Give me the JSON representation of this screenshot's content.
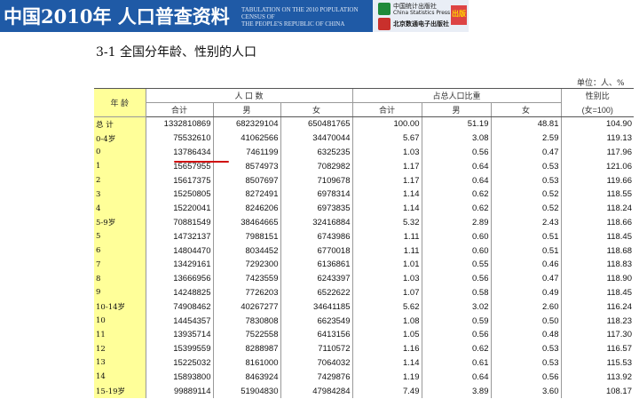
{
  "banner": {
    "title": "中国2010年  人口普查资料",
    "subtitle_line1": "TABULATION ON THE 2010 POPULATION CENSUS OF",
    "subtitle_line2": "THE PEOPLE'S REPUBLIC OF CHINA",
    "press_cn": "中国统计出版社",
    "press_en": "China Statistics Press",
    "publisher": "北京数通电子出版社",
    "badge": "出版"
  },
  "page_title": "3-1  全国分年龄、性别的人口",
  "unit": "单位：人、%",
  "headers": {
    "age": "年    龄",
    "population": "人    口    数",
    "share": "占总人口比重",
    "sex_ratio": "性别比",
    "total": "合计",
    "male": "男",
    "female": "女",
    "ratio_basis": "(女=100)"
  },
  "rows": [
    {
      "age": "总  计",
      "total": "1332810869",
      "male": "682329104",
      "female": "650481765",
      "p_total": "100.00",
      "p_male": "51.19",
      "p_female": "48.81",
      "ratio": "104.90"
    },
    {
      "age": "0-4岁",
      "total": "75532610",
      "male": "41062566",
      "female": "34470044",
      "p_total": "5.67",
      "p_male": "3.08",
      "p_female": "2.59",
      "ratio": "119.13"
    },
    {
      "age": "0",
      "total": "13786434",
      "male": "7461199",
      "female": "6325235",
      "p_total": "1.03",
      "p_male": "0.56",
      "p_female": "0.47",
      "ratio": "117.96"
    },
    {
      "age": "1",
      "total": "15657955",
      "male": "8574973",
      "female": "7082982",
      "p_total": "1.17",
      "p_male": "0.64",
      "p_female": "0.53",
      "ratio": "121.06"
    },
    {
      "age": "2",
      "total": "15617375",
      "male": "8507697",
      "female": "7109678",
      "p_total": "1.17",
      "p_male": "0.64",
      "p_female": "0.53",
      "ratio": "119.66"
    },
    {
      "age": "3",
      "total": "15250805",
      "male": "8272491",
      "female": "6978314",
      "p_total": "1.14",
      "p_male": "0.62",
      "p_female": "0.52",
      "ratio": "118.55"
    },
    {
      "age": "4",
      "total": "15220041",
      "male": "8246206",
      "female": "6973835",
      "p_total": "1.14",
      "p_male": "0.62",
      "p_female": "0.52",
      "ratio": "118.24"
    },
    {
      "age": "5-9岁",
      "total": "70881549",
      "male": "38464665",
      "female": "32416884",
      "p_total": "5.32",
      "p_male": "2.89",
      "p_female": "2.43",
      "ratio": "118.66"
    },
    {
      "age": "5",
      "total": "14732137",
      "male": "7988151",
      "female": "6743986",
      "p_total": "1.11",
      "p_male": "0.60",
      "p_female": "0.51",
      "ratio": "118.45"
    },
    {
      "age": "6",
      "total": "14804470",
      "male": "8034452",
      "female": "6770018",
      "p_total": "1.11",
      "p_male": "0.60",
      "p_female": "0.51",
      "ratio": "118.68"
    },
    {
      "age": "7",
      "total": "13429161",
      "male": "7292300",
      "female": "6136861",
      "p_total": "1.01",
      "p_male": "0.55",
      "p_female": "0.46",
      "ratio": "118.83"
    },
    {
      "age": "8",
      "total": "13666956",
      "male": "7423559",
      "female": "6243397",
      "p_total": "1.03",
      "p_male": "0.56",
      "p_female": "0.47",
      "ratio": "118.90"
    },
    {
      "age": "9",
      "total": "14248825",
      "male": "7726203",
      "female": "6522622",
      "p_total": "1.07",
      "p_male": "0.58",
      "p_female": "0.49",
      "ratio": "118.45"
    },
    {
      "age": "10-14岁",
      "total": "74908462",
      "male": "40267277",
      "female": "34641185",
      "p_total": "5.62",
      "p_male": "3.02",
      "p_female": "2.60",
      "ratio": "116.24"
    },
    {
      "age": "10",
      "total": "14454357",
      "male": "7830808",
      "female": "6623549",
      "p_total": "1.08",
      "p_male": "0.59",
      "p_female": "0.50",
      "ratio": "118.23"
    },
    {
      "age": "11",
      "total": "13935714",
      "male": "7522558",
      "female": "6413156",
      "p_total": "1.05",
      "p_male": "0.56",
      "p_female": "0.48",
      "ratio": "117.30"
    },
    {
      "age": "12",
      "total": "15399559",
      "male": "8288987",
      "female": "7110572",
      "p_total": "1.16",
      "p_male": "0.62",
      "p_female": "0.53",
      "ratio": "116.57"
    },
    {
      "age": "13",
      "total": "15225032",
      "male": "8161000",
      "female": "7064032",
      "p_total": "1.14",
      "p_male": "0.61",
      "p_female": "0.53",
      "ratio": "115.53"
    },
    {
      "age": "14",
      "total": "15893800",
      "male": "8463924",
      "female": "7429876",
      "p_total": "1.19",
      "p_male": "0.64",
      "p_female": "0.56",
      "ratio": "113.92"
    },
    {
      "age": "15-19岁",
      "total": "99889114",
      "male": "51904830",
      "female": "47984284",
      "p_total": "7.49",
      "p_male": "3.89",
      "p_female": "3.60",
      "ratio": "108.17"
    }
  ],
  "colors": {
    "banner": "#1f5aa6",
    "age_column": "#ffff99",
    "underline": "#d01010"
  }
}
